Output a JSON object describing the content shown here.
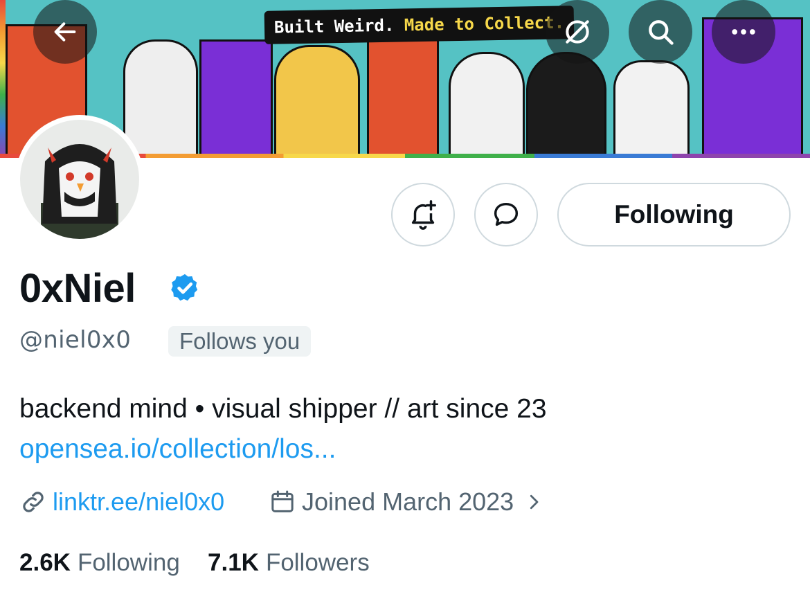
{
  "banner": {
    "tagline_part1": "Built Weird.",
    "tagline_part2": "Made to Collect."
  },
  "nav": {
    "back_icon": "arrow-left-icon",
    "ai_icon": "slashed-circle-icon",
    "search_icon": "search-icon",
    "more_icon": "more-dots-icon"
  },
  "actions": {
    "notify_icon": "bell-plus-icon",
    "message_icon": "chat-bubble-icon",
    "follow_label": "Following"
  },
  "profile": {
    "display_name": "0xNiel",
    "handle": "@niel0x0",
    "follows_you": "Follows you",
    "bio": "backend mind • visual shipper // art since 23",
    "bio_link": "opensea.io/collection/los...",
    "website": "linktr.ee/niel0x0",
    "joined": "Joined March 2023",
    "verified_color": "#1d9bf0"
  },
  "stats": {
    "following_count": "2.6K",
    "following_label": "Following",
    "followers_count": "7.1K",
    "followers_label": "Followers"
  }
}
